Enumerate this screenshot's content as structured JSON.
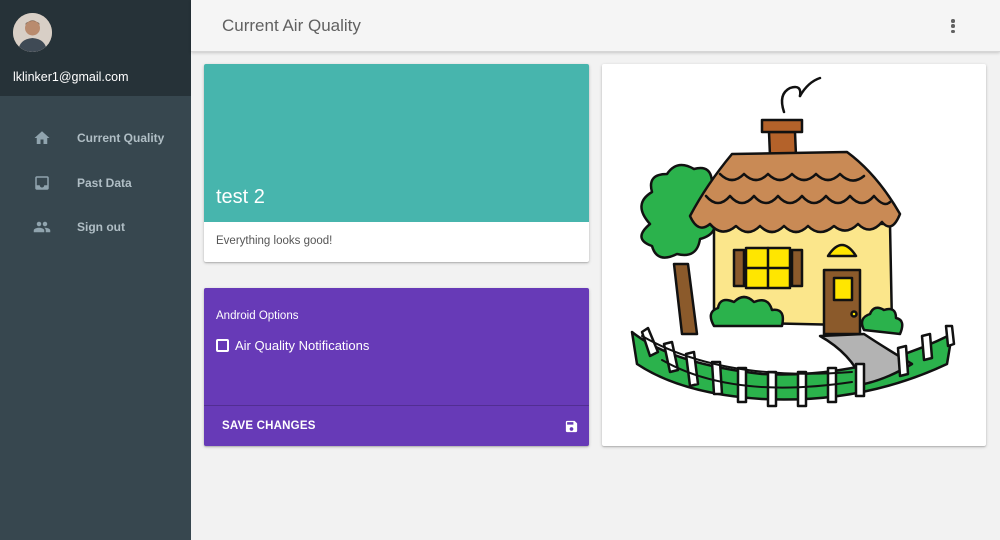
{
  "user": {
    "email": "lklinker1@gmail.com"
  },
  "sidebar": {
    "items": [
      {
        "label": "Current Quality",
        "icon": "home-icon"
      },
      {
        "label": "Past Data",
        "icon": "inbox-icon"
      },
      {
        "label": "Sign out",
        "icon": "people-icon"
      }
    ]
  },
  "header": {
    "title": "Current Air Quality",
    "menu_icon": "more-vert-icon"
  },
  "status_card": {
    "name": "test 2",
    "message": "Everything looks good!",
    "color": "#47b5ad"
  },
  "options_card": {
    "title": "Android Options",
    "checkbox_label": "Air Quality Notifications",
    "checkbox_checked": false,
    "save_label": "SAVE CHANGES",
    "save_icon": "floppy-disk-icon",
    "color": "#673ab7"
  },
  "image_card": {
    "image": "house-illustration"
  }
}
